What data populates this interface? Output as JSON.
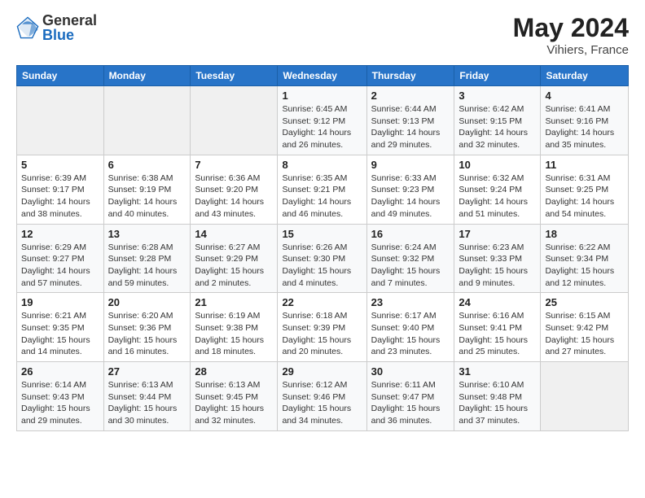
{
  "logo": {
    "general": "General",
    "blue": "Blue"
  },
  "header": {
    "title": "May 2024",
    "subtitle": "Vihiers, France"
  },
  "calendar": {
    "days": [
      "Sunday",
      "Monday",
      "Tuesday",
      "Wednesday",
      "Thursday",
      "Friday",
      "Saturday"
    ]
  },
  "weeks": [
    [
      {
        "day": "",
        "sunrise": "",
        "sunset": "",
        "daylight": "",
        "empty": true
      },
      {
        "day": "",
        "sunrise": "",
        "sunset": "",
        "daylight": "",
        "empty": true
      },
      {
        "day": "",
        "sunrise": "",
        "sunset": "",
        "daylight": "",
        "empty": true
      },
      {
        "day": "1",
        "sunrise": "Sunrise: 6:45 AM",
        "sunset": "Sunset: 9:12 PM",
        "daylight": "Daylight: 14 hours and 26 minutes."
      },
      {
        "day": "2",
        "sunrise": "Sunrise: 6:44 AM",
        "sunset": "Sunset: 9:13 PM",
        "daylight": "Daylight: 14 hours and 29 minutes."
      },
      {
        "day": "3",
        "sunrise": "Sunrise: 6:42 AM",
        "sunset": "Sunset: 9:15 PM",
        "daylight": "Daylight: 14 hours and 32 minutes."
      },
      {
        "day": "4",
        "sunrise": "Sunrise: 6:41 AM",
        "sunset": "Sunset: 9:16 PM",
        "daylight": "Daylight: 14 hours and 35 minutes."
      }
    ],
    [
      {
        "day": "5",
        "sunrise": "Sunrise: 6:39 AM",
        "sunset": "Sunset: 9:17 PM",
        "daylight": "Daylight: 14 hours and 38 minutes."
      },
      {
        "day": "6",
        "sunrise": "Sunrise: 6:38 AM",
        "sunset": "Sunset: 9:19 PM",
        "daylight": "Daylight: 14 hours and 40 minutes."
      },
      {
        "day": "7",
        "sunrise": "Sunrise: 6:36 AM",
        "sunset": "Sunset: 9:20 PM",
        "daylight": "Daylight: 14 hours and 43 minutes."
      },
      {
        "day": "8",
        "sunrise": "Sunrise: 6:35 AM",
        "sunset": "Sunset: 9:21 PM",
        "daylight": "Daylight: 14 hours and 46 minutes."
      },
      {
        "day": "9",
        "sunrise": "Sunrise: 6:33 AM",
        "sunset": "Sunset: 9:23 PM",
        "daylight": "Daylight: 14 hours and 49 minutes."
      },
      {
        "day": "10",
        "sunrise": "Sunrise: 6:32 AM",
        "sunset": "Sunset: 9:24 PM",
        "daylight": "Daylight: 14 hours and 51 minutes."
      },
      {
        "day": "11",
        "sunrise": "Sunrise: 6:31 AM",
        "sunset": "Sunset: 9:25 PM",
        "daylight": "Daylight: 14 hours and 54 minutes."
      }
    ],
    [
      {
        "day": "12",
        "sunrise": "Sunrise: 6:29 AM",
        "sunset": "Sunset: 9:27 PM",
        "daylight": "Daylight: 14 hours and 57 minutes."
      },
      {
        "day": "13",
        "sunrise": "Sunrise: 6:28 AM",
        "sunset": "Sunset: 9:28 PM",
        "daylight": "Daylight: 14 hours and 59 minutes."
      },
      {
        "day": "14",
        "sunrise": "Sunrise: 6:27 AM",
        "sunset": "Sunset: 9:29 PM",
        "daylight": "Daylight: 15 hours and 2 minutes."
      },
      {
        "day": "15",
        "sunrise": "Sunrise: 6:26 AM",
        "sunset": "Sunset: 9:30 PM",
        "daylight": "Daylight: 15 hours and 4 minutes."
      },
      {
        "day": "16",
        "sunrise": "Sunrise: 6:24 AM",
        "sunset": "Sunset: 9:32 PM",
        "daylight": "Daylight: 15 hours and 7 minutes."
      },
      {
        "day": "17",
        "sunrise": "Sunrise: 6:23 AM",
        "sunset": "Sunset: 9:33 PM",
        "daylight": "Daylight: 15 hours and 9 minutes."
      },
      {
        "day": "18",
        "sunrise": "Sunrise: 6:22 AM",
        "sunset": "Sunset: 9:34 PM",
        "daylight": "Daylight: 15 hours and 12 minutes."
      }
    ],
    [
      {
        "day": "19",
        "sunrise": "Sunrise: 6:21 AM",
        "sunset": "Sunset: 9:35 PM",
        "daylight": "Daylight: 15 hours and 14 minutes."
      },
      {
        "day": "20",
        "sunrise": "Sunrise: 6:20 AM",
        "sunset": "Sunset: 9:36 PM",
        "daylight": "Daylight: 15 hours and 16 minutes."
      },
      {
        "day": "21",
        "sunrise": "Sunrise: 6:19 AM",
        "sunset": "Sunset: 9:38 PM",
        "daylight": "Daylight: 15 hours and 18 minutes."
      },
      {
        "day": "22",
        "sunrise": "Sunrise: 6:18 AM",
        "sunset": "Sunset: 9:39 PM",
        "daylight": "Daylight: 15 hours and 20 minutes."
      },
      {
        "day": "23",
        "sunrise": "Sunrise: 6:17 AM",
        "sunset": "Sunset: 9:40 PM",
        "daylight": "Daylight: 15 hours and 23 minutes."
      },
      {
        "day": "24",
        "sunrise": "Sunrise: 6:16 AM",
        "sunset": "Sunset: 9:41 PM",
        "daylight": "Daylight: 15 hours and 25 minutes."
      },
      {
        "day": "25",
        "sunrise": "Sunrise: 6:15 AM",
        "sunset": "Sunset: 9:42 PM",
        "daylight": "Daylight: 15 hours and 27 minutes."
      }
    ],
    [
      {
        "day": "26",
        "sunrise": "Sunrise: 6:14 AM",
        "sunset": "Sunset: 9:43 PM",
        "daylight": "Daylight: 15 hours and 29 minutes."
      },
      {
        "day": "27",
        "sunrise": "Sunrise: 6:13 AM",
        "sunset": "Sunset: 9:44 PM",
        "daylight": "Daylight: 15 hours and 30 minutes."
      },
      {
        "day": "28",
        "sunrise": "Sunrise: 6:13 AM",
        "sunset": "Sunset: 9:45 PM",
        "daylight": "Daylight: 15 hours and 32 minutes."
      },
      {
        "day": "29",
        "sunrise": "Sunrise: 6:12 AM",
        "sunset": "Sunset: 9:46 PM",
        "daylight": "Daylight: 15 hours and 34 minutes."
      },
      {
        "day": "30",
        "sunrise": "Sunrise: 6:11 AM",
        "sunset": "Sunset: 9:47 PM",
        "daylight": "Daylight: 15 hours and 36 minutes."
      },
      {
        "day": "31",
        "sunrise": "Sunrise: 6:10 AM",
        "sunset": "Sunset: 9:48 PM",
        "daylight": "Daylight: 15 hours and 37 minutes."
      },
      {
        "day": "",
        "sunrise": "",
        "sunset": "",
        "daylight": "",
        "empty": true
      }
    ]
  ]
}
